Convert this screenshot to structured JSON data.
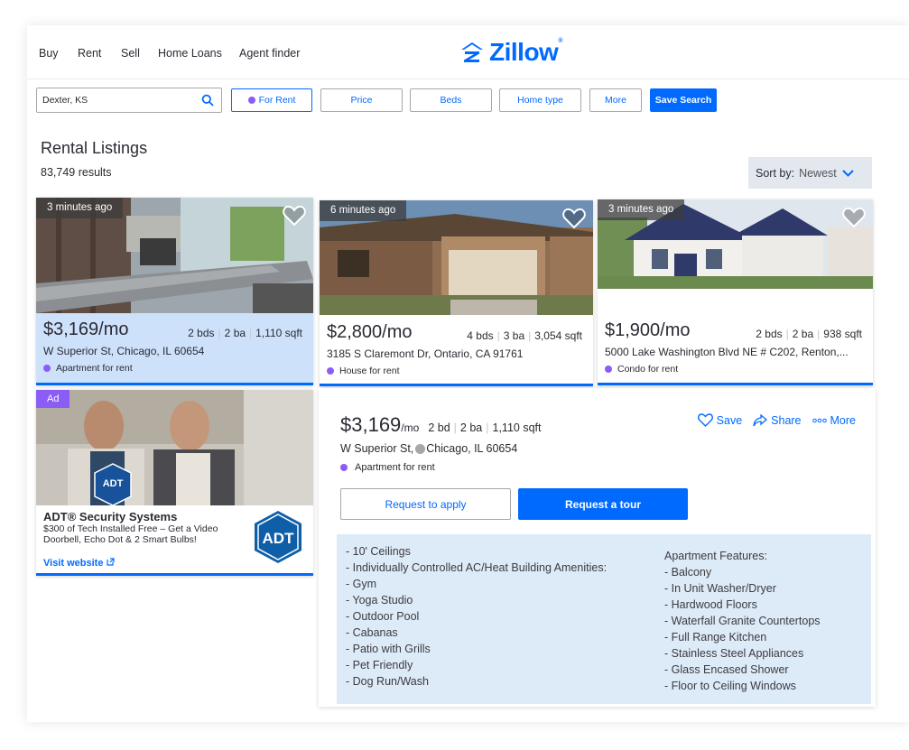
{
  "nav": {
    "links": [
      "Buy",
      "Rent",
      "Sell",
      "Home Loans",
      "Agent finder"
    ],
    "logo_text": "Zillow"
  },
  "search": {
    "value": "Dexter, KS"
  },
  "filters": {
    "for_rent": "For Rent",
    "price": "Price",
    "beds": "Beds",
    "home_type": "Home type",
    "more": "More",
    "save_search": "Save Search"
  },
  "listing_header": {
    "title": "Rental Listings",
    "results": "83,749 results",
    "sort_label": "Sort by:",
    "sort_value": "Newest"
  },
  "cards": [
    {
      "time_ago": "3 minutes ago",
      "price": "$3,169/mo",
      "beds": "2",
      "beds_unit": "bds",
      "baths": "2",
      "baths_unit": "ba",
      "sqft": "1,110",
      "sqft_unit": "sqft",
      "address": "W Superior St, Chicago, IL 60654",
      "type": "Apartment for rent"
    },
    {
      "time_ago": "6 minutes ago",
      "price": "$2,800/mo",
      "beds": "4",
      "beds_unit": "bds",
      "baths": "3",
      "baths_unit": "ba",
      "sqft": "3,054",
      "sqft_unit": "sqft",
      "address": "3185 S Claremont Dr, Ontario, CA 91761",
      "type": "House for rent"
    },
    {
      "time_ago": "3 minutes ago",
      "price": "$1,900/mo",
      "beds": "2",
      "beds_unit": "bds",
      "baths": "2",
      "baths_unit": "ba",
      "sqft": "938",
      "sqft_unit": "sqft",
      "address": "5000 Lake Washington Blvd NE # C202, Renton,...",
      "type": "Condo for rent"
    }
  ],
  "ad": {
    "tag": "Ad",
    "title": "ADT® Security Systems",
    "description": "$300 of Tech Installed Free – Get a Video Doorbell, Echo Dot & 2 Smart Bulbs!",
    "link": "Visit website",
    "logo_text": "ADT",
    "sign_text": "ADT"
  },
  "detail": {
    "price": "$3,169",
    "per": "/mo",
    "beds": "2",
    "beds_unit": "bd",
    "baths": "2",
    "baths_unit": "ba",
    "sqft": "1,110",
    "sqft_unit": "sqft",
    "street": "W Superior St,",
    "city": "Chicago, IL 60654",
    "type": "Apartment for rent",
    "save": "Save",
    "share": "Share",
    "more": "More",
    "apply": "Request to apply",
    "tour": "Request a tour",
    "features_left": [
      "- 10' Ceilings",
      "- Individually Controlled AC/Heat Building Amenities:",
      "- Gym",
      "- Yoga Studio",
      "- Outdoor Pool",
      "- Cabanas",
      "- Patio with Grills",
      "- Pet Friendly",
      "- Dog Run/Wash"
    ],
    "features_right": [
      "Apartment Features:",
      "- Balcony",
      "- In Unit Washer/Dryer",
      "- Hardwood Floors",
      "- Waterfall Granite Countertops",
      "- Full Range Kitchen",
      "- Stainless Steel Appliances",
      "- Glass Encased Shower",
      "- Floor to Ceiling Windows"
    ]
  },
  "colors": {
    "brand_blue": "#006aff",
    "purple_dot": "#8b5cf6",
    "selected_card_bg": "#cde1fb",
    "features_bg": "#ddeaf8"
  }
}
